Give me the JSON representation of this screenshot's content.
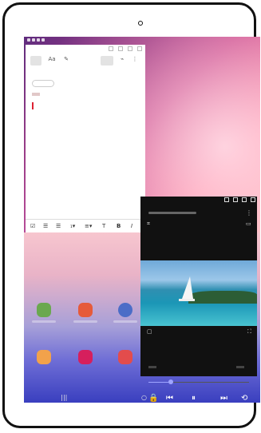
{
  "device": {
    "frame_color": "#111111"
  },
  "notes_app": {
    "toolbar": {
      "items": [
        {
          "label": "",
          "icon": "note-icon"
        },
        {
          "label": "Aa",
          "icon": "text-icon"
        },
        {
          "label": "",
          "icon": "pen-icon"
        },
        {
          "label": "",
          "icon": "attach-icon"
        },
        {
          "label": "⋮",
          "icon": "more-icon"
        }
      ]
    },
    "footer_icons": [
      "checkbox-icon",
      "list-icon",
      "list-icon",
      "font-size-icon",
      "align-icon",
      "underline-icon",
      "bold-icon",
      "italic-icon"
    ]
  },
  "video_app": {
    "icons": [
      "pip-icon",
      "more-icon",
      "screenshot-icon",
      "caption-icon",
      "popup-icon",
      "fullscreen-icon",
      "lock-icon",
      "prev-icon",
      "pause-icon",
      "next-icon",
      "rotate-icon"
    ],
    "progress": 0.21
  },
  "nav": {
    "recent": "|||",
    "home": "○",
    "back": "‹"
  }
}
